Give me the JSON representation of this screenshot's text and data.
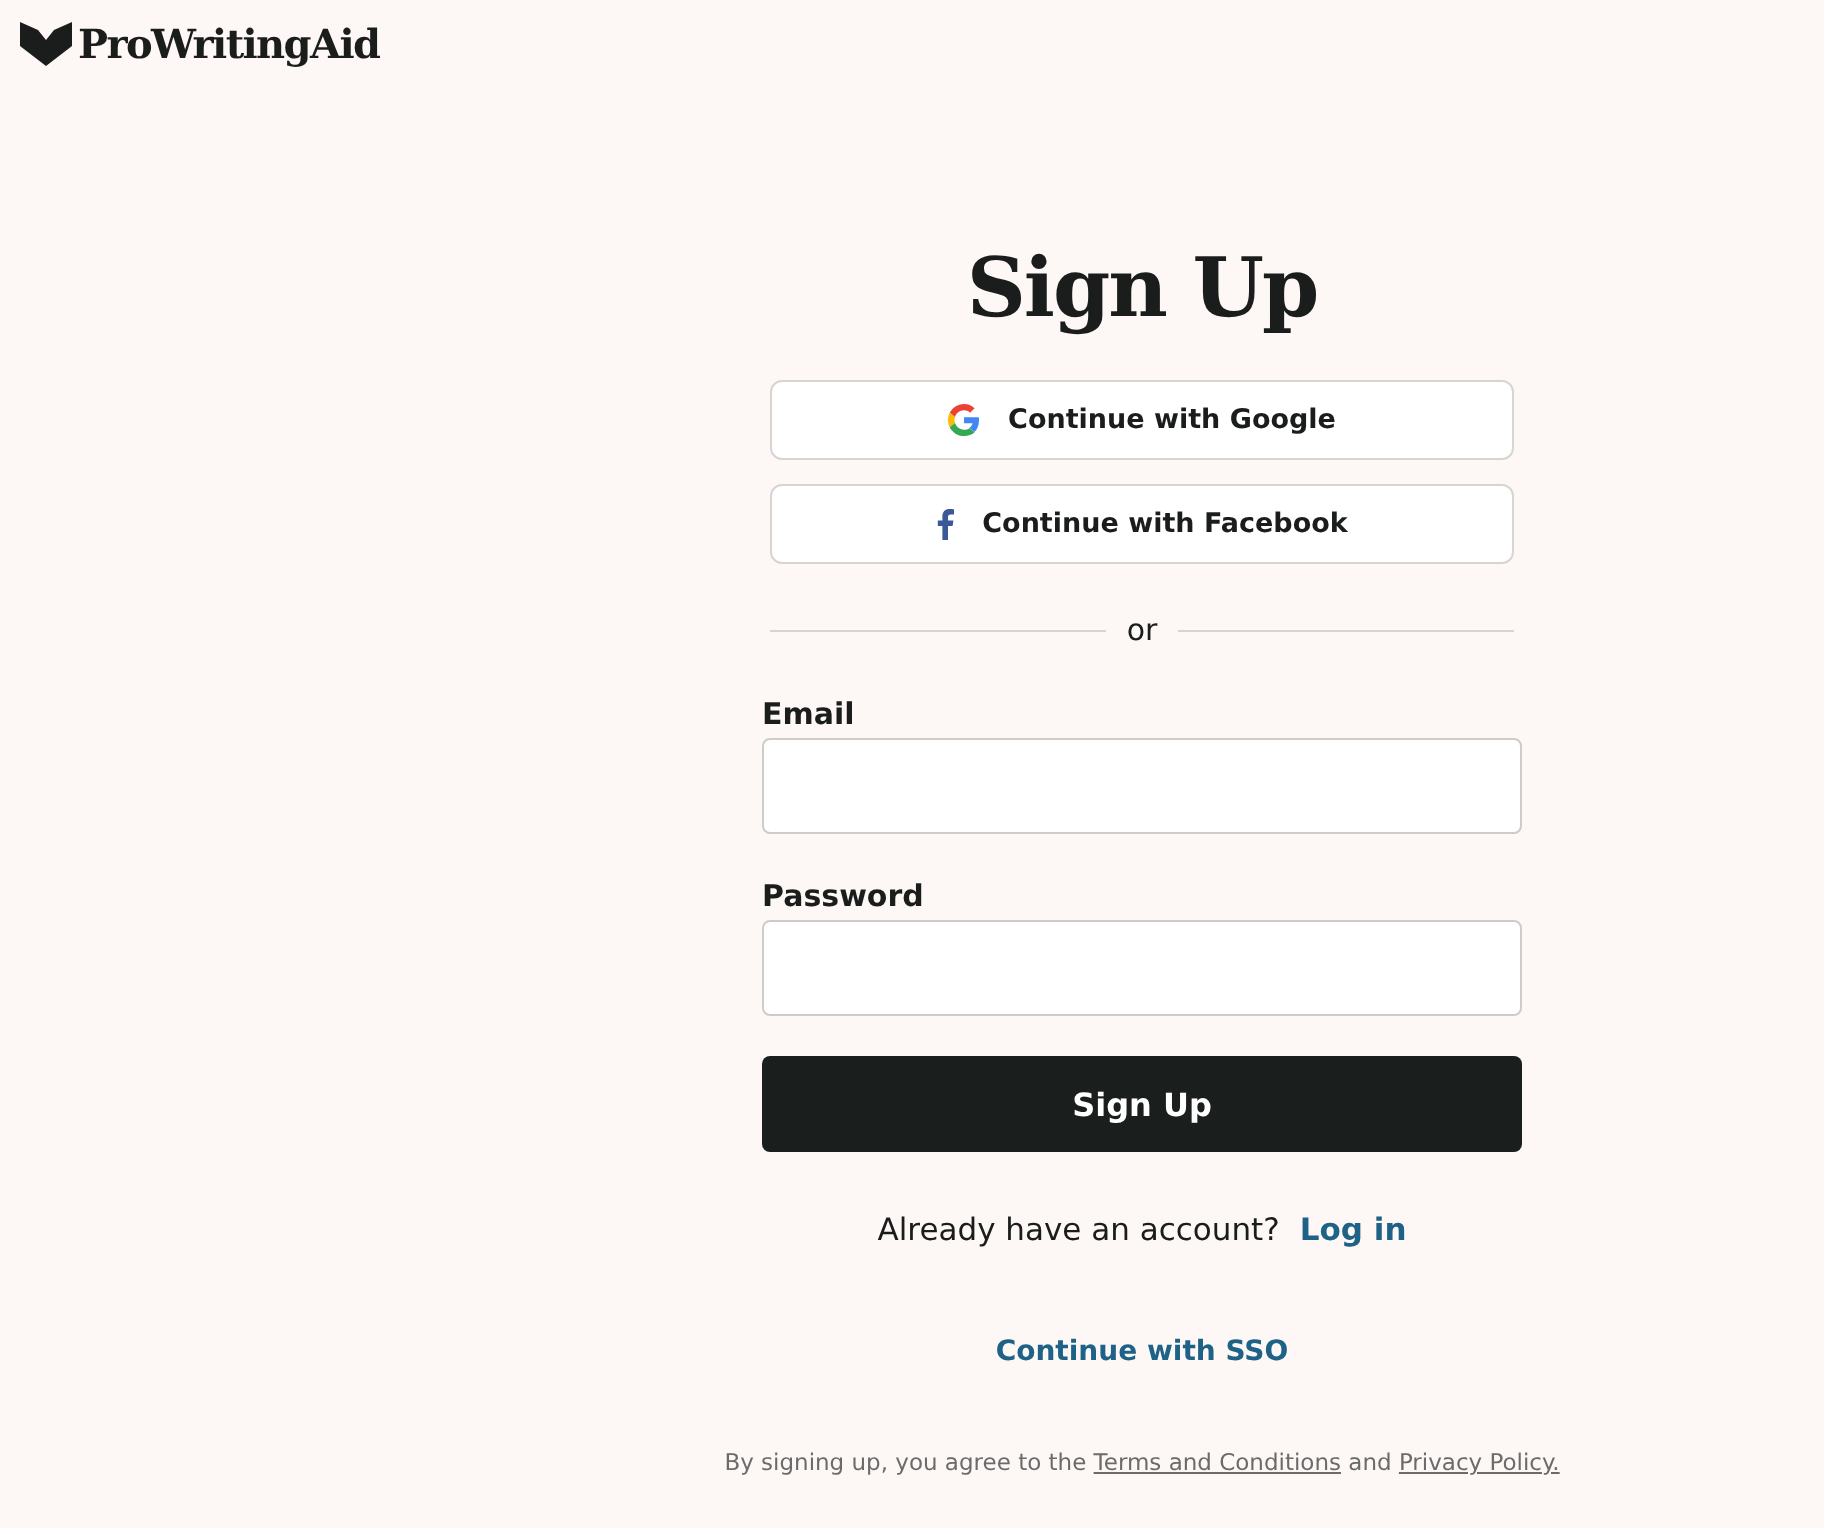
{
  "logo": {
    "text": "ProWritingAid"
  },
  "title": "Sign Up",
  "social_buttons": [
    {
      "kind": "google",
      "label": "Continue with Google"
    },
    {
      "kind": "facebook",
      "label": "Continue with Facebook"
    }
  ],
  "divider": "or",
  "fields": [
    {
      "label": "Email"
    },
    {
      "label": "Password"
    }
  ],
  "submit": "Sign Up",
  "login_prompt": {
    "text": "Already have an account?",
    "link": "Log in"
  },
  "sso_link": "Continue with SSO",
  "consent": {
    "before": "By signing up, you agree to the",
    "terms": "Terms and Conditions",
    "middle": "and",
    "privacy": "Privacy Policy."
  }
}
